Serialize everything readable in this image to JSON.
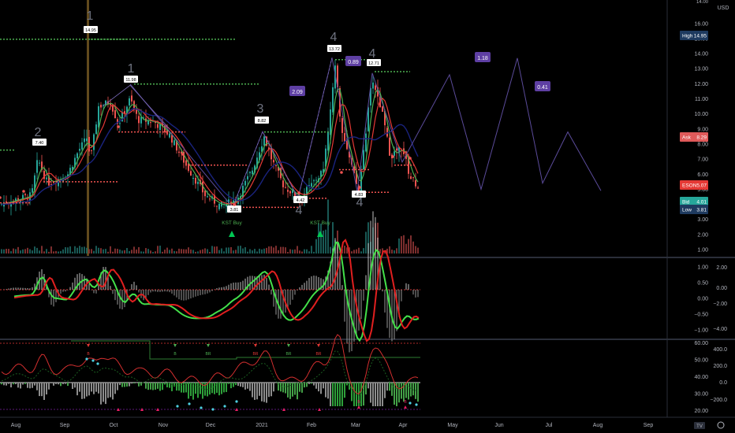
{
  "app": {
    "currency": "USD",
    "tv_logo": "TV"
  },
  "price_scale": {
    "ticks": [
      "16.00",
      "15.00",
      "14.00",
      "13.00",
      "12.00",
      "11.00",
      "10.00",
      "9.00",
      "8.00",
      "7.00",
      "6.00",
      "5.00",
      "4.00",
      "3.00",
      "2.00",
      "1.00"
    ],
    "values": [
      16,
      15,
      14,
      13,
      12,
      11,
      10,
      9,
      8,
      7,
      6,
      5,
      4,
      3,
      2,
      1
    ],
    "top_partial": "14.00"
  },
  "badges": {
    "high": {
      "label": "High",
      "value": "14.95",
      "color": "#1e3a5f"
    },
    "ask": {
      "label": "Ask",
      "value": "8.29",
      "color": "#e05a5a"
    },
    "last": {
      "label": "ESON",
      "value": "5.07",
      "color": "#e53935"
    },
    "bid": {
      "label": "Bid",
      "value": "4.01",
      "color": "#26a69a"
    },
    "low": {
      "label": "Low",
      "value": "3.81",
      "color": "#1e3a5f"
    }
  },
  "macd_scale": {
    "left_ticks": [
      "1.00",
      "0.50",
      "0.00",
      "−0.50",
      "−1.00"
    ],
    "right_ticks": [
      "2.00",
      "0.00",
      "−2.00",
      "−4.00"
    ]
  },
  "osc_scale": {
    "left_ticks": [
      "60.00",
      "50.00",
      "40.00",
      "30.00",
      "20.00"
    ],
    "right_ticks": [
      "400.0",
      "200.0",
      "0.0",
      "−200.0"
    ]
  },
  "time_axis": [
    "Aug",
    "Sep",
    "Oct",
    "Nov",
    "Dec",
    "2021",
    "Feb",
    "Mar",
    "Apr",
    "May",
    "Jun",
    "Jul",
    "Aug",
    "Sep"
  ],
  "wave_labels": [
    {
      "text": "1",
      "kind": "big"
    },
    {
      "text": "2",
      "kind": "big"
    },
    {
      "text": "1",
      "kind": "big"
    },
    {
      "text": "3",
      "kind": "big"
    },
    {
      "text": "4",
      "kind": "big"
    },
    {
      "text": "4",
      "kind": "big"
    },
    {
      "text": "4",
      "kind": "big"
    },
    {
      "text": "4",
      "kind": "big"
    }
  ],
  "price_tags": [
    "14.95",
    "11.98",
    "7.40",
    "8.82",
    "3.81",
    "4.42",
    "13.72",
    "12.71",
    "4.83"
  ],
  "ratio_boxes": [
    "2.09",
    "0.89",
    "1.18",
    "0.41"
  ],
  "signals": [
    {
      "text": "KST Buy"
    },
    {
      "text": "KST Buy"
    }
  ],
  "osc_markers": [
    "B",
    "B",
    "BR",
    "BR",
    "BR",
    "BR",
    "B",
    "B"
  ],
  "chart_data": {
    "type": "line",
    "title": "",
    "xlabel": "",
    "ylabel": "",
    "ylim": [
      1,
      16
    ],
    "series": [
      {
        "name": "",
        "x": [
          "Aug",
          "Sep",
          "Oct",
          "Nov",
          "Dec",
          "2021",
          "Feb",
          "Mar",
          "Apr"
        ],
        "values": [
          4.2,
          6.5,
          10.2,
          9.0,
          4.0,
          4.4,
          9.5,
          10.5,
          5.1
        ]
      }
    ]
  }
}
